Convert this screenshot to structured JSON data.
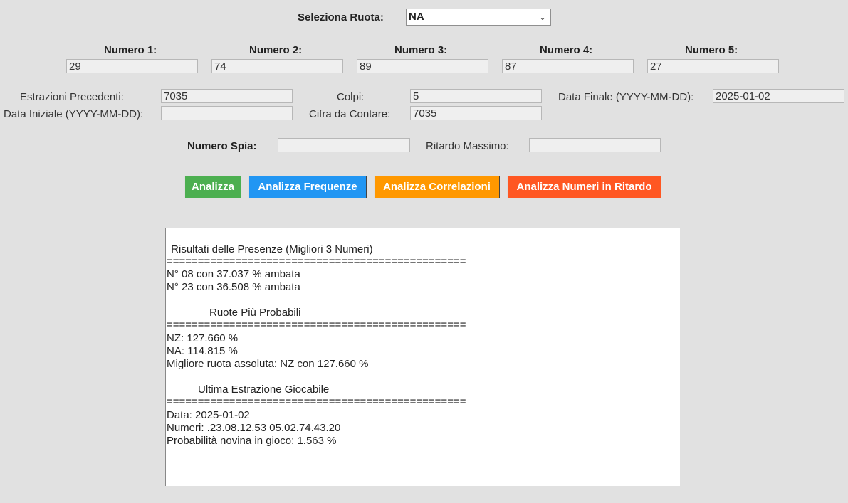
{
  "ruota": {
    "label": "Seleziona Ruota:",
    "value": "NA"
  },
  "numbers": [
    {
      "label": "Numero 1:",
      "value": "29"
    },
    {
      "label": "Numero 2:",
      "value": "74"
    },
    {
      "label": "Numero 3:",
      "value": "89"
    },
    {
      "label": "Numero 4:",
      "value": "87"
    },
    {
      "label": "Numero 5:",
      "value": "27"
    }
  ],
  "params": {
    "estrazioni_label": "Estrazioni Precedenti:",
    "estrazioni_value": "7035",
    "colpi_label": "Colpi:",
    "colpi_value": "5",
    "data_finale_label": "Data Finale (YYYY-MM-DD):",
    "data_finale_value": "2025-01-02",
    "data_iniziale_label": "Data Iniziale (YYYY-MM-DD):",
    "data_iniziale_value": "",
    "cifra_label": "Cifra da Contare:",
    "cifra_value": "7035"
  },
  "spia": {
    "label": "Numero Spia:",
    "value": "",
    "ritardo_label": "Ritardo Massimo:",
    "ritardo_value": ""
  },
  "buttons": {
    "analizza": "Analizza",
    "frequenze": "Analizza Frequenze",
    "correlazioni": "Analizza Correlazioni",
    "ritardo": "Analizza Numeri in Ritardo"
  },
  "colors": {
    "analizza": "#4caf50",
    "frequenze": "#2196f3",
    "correlazioni": "#ff9800",
    "ritardo": "#ff5722"
  },
  "output": {
    "presenze_title": " Risultati delle Presenze (Migliori 3 Numeri)",
    "separator": "================================================",
    "presenze_1": "N° 08 con 37.037 % ambata",
    "presenze_2": "N° 23 con 36.508 % ambata",
    "ruote_title": "Ruote Più Probabili",
    "ruote_1": "NZ: 127.660 %",
    "ruote_2": "NA: 114.815 %",
    "ruote_3": "Migliore ruota assoluta: NZ con 127.660 %",
    "ultima_title": "Ultima Estrazione Giocabile",
    "ultima_1": "Data: 2025-01-02",
    "ultima_2": "Numeri: .23.08.12.53 05.02.74.43.20",
    "ultima_3": "Probabilità novina in gioco: 1.563 %"
  }
}
